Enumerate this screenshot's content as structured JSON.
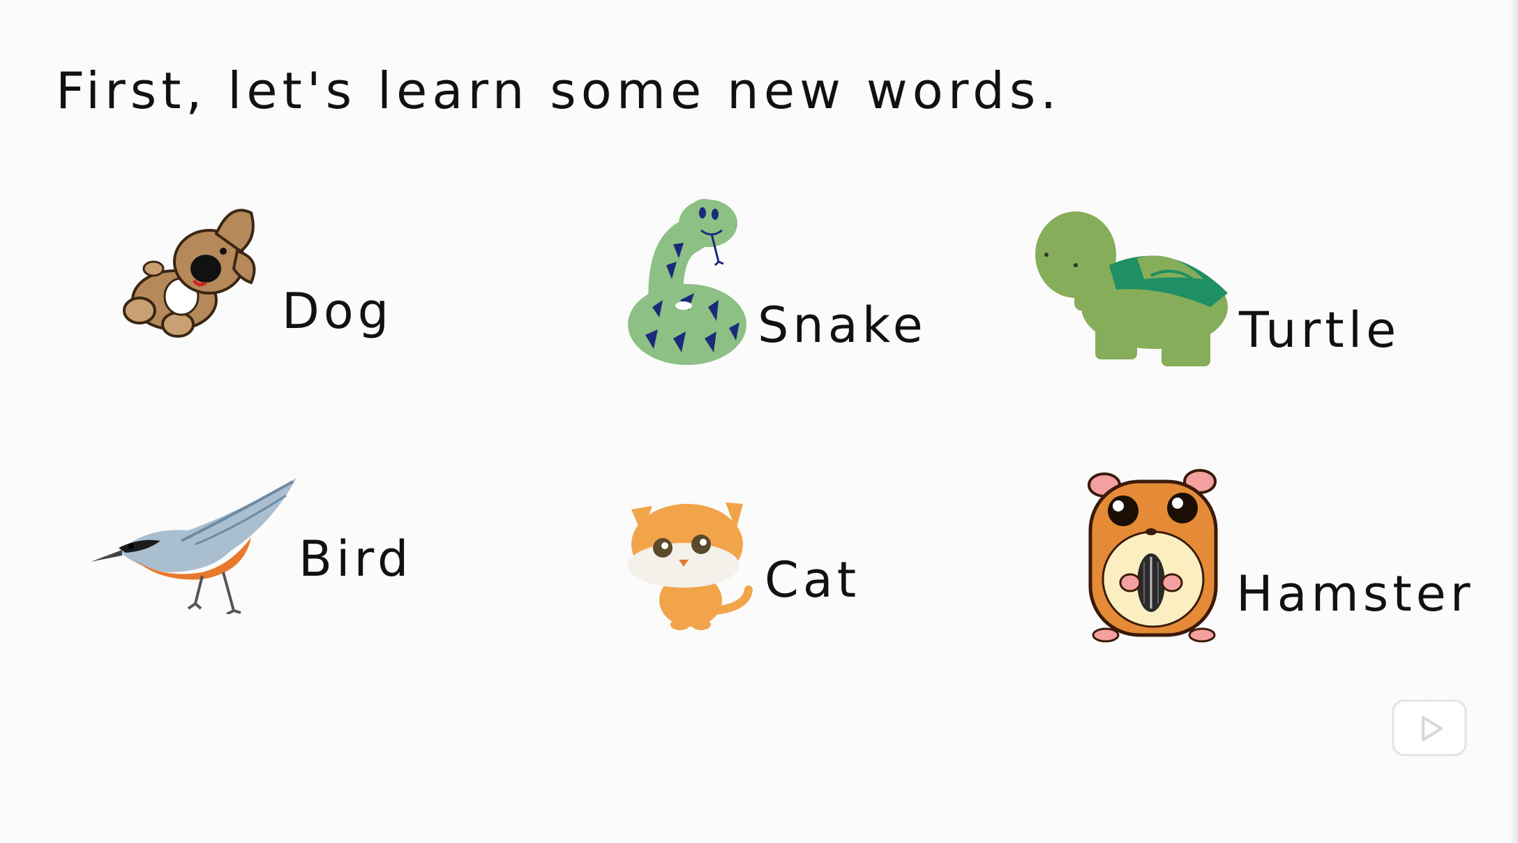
{
  "heading": "First, let's learn some new words.",
  "words": {
    "dog": "Dog",
    "snake": "Snake",
    "turtle": "Turtle",
    "bird": "Bird",
    "cat": "Cat",
    "hamster": "Hamster"
  },
  "icons": {
    "player": "tv-play-icon"
  },
  "colors": {
    "text": "#111111",
    "background": "#fbfbfb"
  }
}
